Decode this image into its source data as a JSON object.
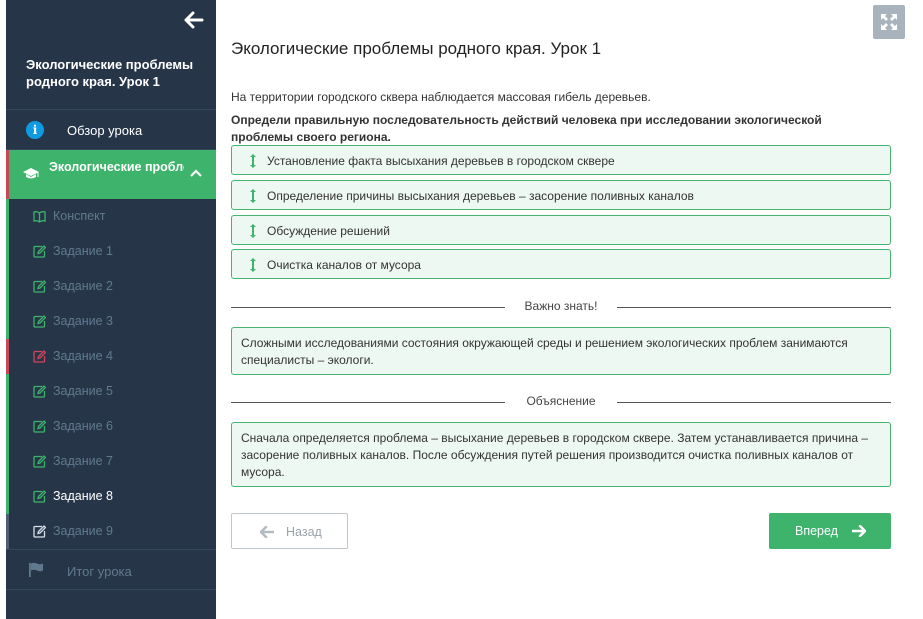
{
  "sidebar": {
    "course_title": "Экологические проблемы родного края. Урок 1",
    "overview_label": "Обзор урока",
    "lesson_label": "Экологические проблемы родного...",
    "items": [
      {
        "label": "Конспект",
        "icon": "book-icon",
        "status_color": "#3db36b"
      },
      {
        "label": "Задание 1",
        "icon": "edit-icon",
        "status_color": "#3db36b"
      },
      {
        "label": "Задание 2",
        "icon": "edit-icon",
        "status_color": "#3db36b"
      },
      {
        "label": "Задание 3",
        "icon": "edit-icon",
        "status_color": "#3db36b"
      },
      {
        "label": "Задание 4",
        "icon": "edit-icon",
        "status_color": "#c64756"
      },
      {
        "label": "Задание 5",
        "icon": "edit-icon",
        "status_color": "#3db36b"
      },
      {
        "label": "Задание 6",
        "icon": "edit-icon",
        "status_color": "#3db36b"
      },
      {
        "label": "Задание 7",
        "icon": "edit-icon",
        "status_color": "#3db36b"
      },
      {
        "label": "Задание 8",
        "icon": "edit-icon",
        "status_color": "#3db36b"
      },
      {
        "label": "Задание 9",
        "icon": "edit-icon",
        "status_color": "#4d5f70"
      }
    ],
    "summary_label": "Итог урока"
  },
  "main": {
    "title": "Экологические проблемы родного края. Урок 1",
    "intro": "На территории городского сквера наблюдается массовая гибель деревьев.",
    "question": "Определи правильную последовательность действий человека при исследовании экологической проблемы своего региона.",
    "answers": [
      "Установление факта высыхания деревьев в городском сквере",
      "Определение причины высыхания деревьев – засорение поливных каналов",
      "Обсуждение решений",
      "Очистка каналов от мусора"
    ],
    "important_heading": "Важно знать!",
    "important_text": "Сложными исследованиями состояния окружающей среды и решением экологических проблем занимаются специалисты – экологи.",
    "explanation_heading": "Объяснение",
    "explanation_text": "Сначала определяется проблема – высыхание деревьев в городском сквере. Затем устанавливается причина – засорение поливных каналов. После обсуждения путей решения производится очистка поливных каналов от мусора.",
    "back_label": "Назад",
    "next_label": "Вперед"
  },
  "colors": {
    "accent": "#3db36b",
    "sidebar_bg": "#263648",
    "error": "#c64756",
    "info": "#0e9be3"
  }
}
